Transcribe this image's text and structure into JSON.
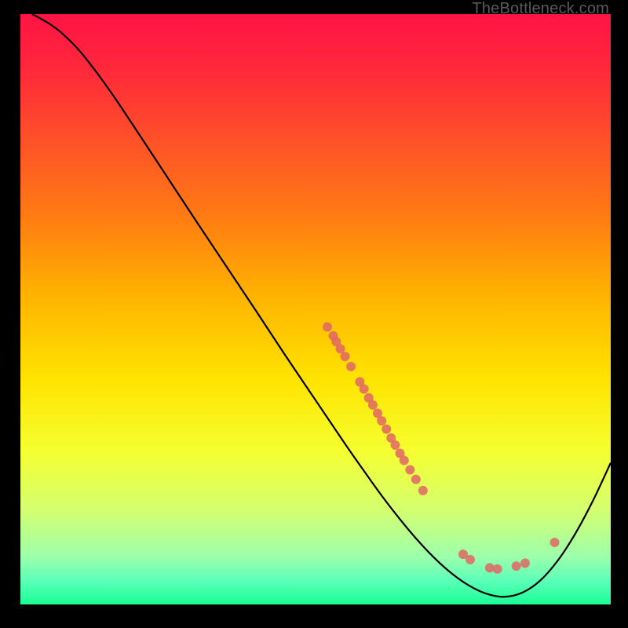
{
  "watermark": "TheBottleneck.com",
  "chart_data": {
    "type": "line",
    "title": "",
    "xlabel": "",
    "ylabel": "",
    "xlim": [
      0,
      100
    ],
    "ylim": [
      0,
      100
    ],
    "gradient_stops": [
      {
        "offset": 0.0,
        "color": "#ff1345"
      },
      {
        "offset": 0.1,
        "color": "#ff2a3a"
      },
      {
        "offset": 0.22,
        "color": "#ff5327"
      },
      {
        "offset": 0.35,
        "color": "#ff7e12"
      },
      {
        "offset": 0.48,
        "color": "#ffb400"
      },
      {
        "offset": 0.62,
        "color": "#ffe400"
      },
      {
        "offset": 0.74,
        "color": "#f5ff30"
      },
      {
        "offset": 0.84,
        "color": "#d4ff70"
      },
      {
        "offset": 0.92,
        "color": "#9cffac"
      },
      {
        "offset": 0.96,
        "color": "#5bffb8"
      },
      {
        "offset": 1.0,
        "color": "#1aff95"
      }
    ],
    "curve": [
      {
        "x": 2.0,
        "y": 100.0
      },
      {
        "x": 3.5,
        "y": 99.2
      },
      {
        "x": 5.0,
        "y": 98.3
      },
      {
        "x": 7.0,
        "y": 96.8
      },
      {
        "x": 10.0,
        "y": 93.8
      },
      {
        "x": 13.0,
        "y": 90.0
      },
      {
        "x": 16.0,
        "y": 85.8
      },
      {
        "x": 20.0,
        "y": 79.8
      },
      {
        "x": 25.0,
        "y": 72.2
      },
      {
        "x": 30.0,
        "y": 64.6
      },
      {
        "x": 35.0,
        "y": 57.1
      },
      {
        "x": 40.0,
        "y": 49.6
      },
      {
        "x": 45.0,
        "y": 42.0
      },
      {
        "x": 50.0,
        "y": 34.6
      },
      {
        "x": 55.0,
        "y": 27.2
      },
      {
        "x": 58.0,
        "y": 22.9
      },
      {
        "x": 61.0,
        "y": 18.7
      },
      {
        "x": 64.0,
        "y": 14.8
      },
      {
        "x": 67.0,
        "y": 11.2
      },
      {
        "x": 70.0,
        "y": 8.0
      },
      {
        "x": 73.0,
        "y": 5.3
      },
      {
        "x": 76.0,
        "y": 3.2
      },
      {
        "x": 79.0,
        "y": 1.8
      },
      {
        "x": 82.0,
        "y": 1.3
      },
      {
        "x": 85.0,
        "y": 2.0
      },
      {
        "x": 88.0,
        "y": 4.0
      },
      {
        "x": 91.0,
        "y": 7.4
      },
      {
        "x": 94.0,
        "y": 12.0
      },
      {
        "x": 97.0,
        "y": 17.6
      },
      {
        "x": 100.0,
        "y": 24.0
      }
    ],
    "scatter": [
      {
        "x": 52.0,
        "y": 47.0
      },
      {
        "x": 53.0,
        "y": 45.5
      },
      {
        "x": 53.5,
        "y": 44.5
      },
      {
        "x": 54.2,
        "y": 43.3
      },
      {
        "x": 55.0,
        "y": 42.0
      },
      {
        "x": 56.0,
        "y": 40.3
      },
      {
        "x": 57.5,
        "y": 37.7
      },
      {
        "x": 58.2,
        "y": 36.5
      },
      {
        "x": 59.0,
        "y": 35.0
      },
      {
        "x": 59.7,
        "y": 33.8
      },
      {
        "x": 60.5,
        "y": 32.4
      },
      {
        "x": 61.2,
        "y": 31.1
      },
      {
        "x": 62.0,
        "y": 29.7
      },
      {
        "x": 62.8,
        "y": 28.2
      },
      {
        "x": 63.5,
        "y": 27.0
      },
      {
        "x": 64.3,
        "y": 25.6
      },
      {
        "x": 65.0,
        "y": 24.4
      },
      {
        "x": 66.0,
        "y": 22.8
      },
      {
        "x": 67.0,
        "y": 21.2
      },
      {
        "x": 68.2,
        "y": 19.3
      },
      {
        "x": 75.0,
        "y": 8.5
      },
      {
        "x": 76.2,
        "y": 7.6
      },
      {
        "x": 79.5,
        "y": 6.2
      },
      {
        "x": 80.8,
        "y": 6.0
      },
      {
        "x": 84.0,
        "y": 6.5
      },
      {
        "x": 85.5,
        "y": 7.0
      },
      {
        "x": 90.5,
        "y": 10.5
      }
    ],
    "scatter_color": "#e06666",
    "scatter_radius": 6
  }
}
